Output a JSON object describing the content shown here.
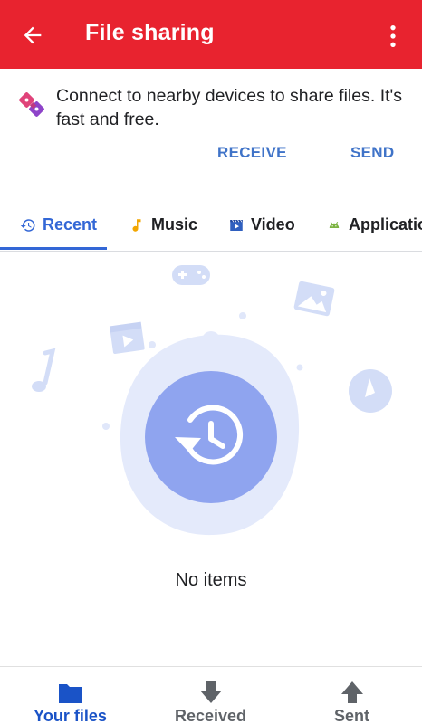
{
  "appbar": {
    "title": "File sharing",
    "back_icon": "arrow-back-icon",
    "menu_icon": "more-vert-icon",
    "color": "#e8232f"
  },
  "promo": {
    "text": "Connect to nearby devices to share files. It's fast and free.",
    "receive_label": "RECEIVE",
    "send_label": "SEND",
    "accent": "#3f73c8"
  },
  "tabs": [
    {
      "label": "Recent",
      "icon": "history-icon",
      "selected": true
    },
    {
      "label": "Music",
      "icon": "music-note-icon",
      "selected": false
    },
    {
      "label": "Video",
      "icon": "video-icon",
      "selected": false
    },
    {
      "label": "Applicatio",
      "icon": "android-icon",
      "selected": false
    }
  ],
  "empty_state": {
    "message": "No items",
    "icon": "history-icon"
  },
  "bottom_nav": [
    {
      "label": "Your files",
      "icon": "folder-icon",
      "active": true
    },
    {
      "label": "Received",
      "icon": "download-icon",
      "active": false
    },
    {
      "label": "Sent",
      "icon": "upload-icon",
      "active": false
    }
  ]
}
